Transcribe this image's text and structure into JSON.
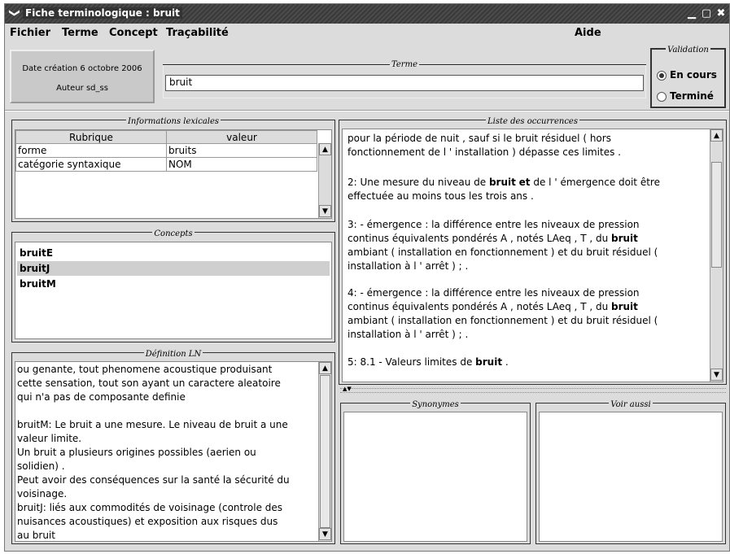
{
  "window": {
    "title": "Fiche terminologique : bruit",
    "menu_glyph": "❯",
    "min_glyph": "▁",
    "max_glyph": "▢",
    "close_glyph": "✖"
  },
  "menu": {
    "fichier": "Fichier",
    "terme": "Terme",
    "concept": "Concept",
    "tracabilite": "Traçabilité",
    "aide": "Aide"
  },
  "header": {
    "date_creation": "Date création  6 octobre 2006",
    "auteur": "Auteur sd_ss",
    "terme_legend": "Terme",
    "terme_value": "bruit",
    "validation_legend": "Validation",
    "en_cours": "En cours",
    "termine": "Terminé"
  },
  "lexical": {
    "legend": "Informations lexicales",
    "col_rubrique": "Rubrique",
    "col_valeur": "valeur",
    "rows": [
      {
        "rubrique": "forme",
        "valeur": "bruits"
      },
      {
        "rubrique": "catégorie syntaxique",
        "valeur": "NOM"
      }
    ]
  },
  "concepts": {
    "legend": "Concepts",
    "items": [
      "bruitE",
      "bruitJ",
      "bruitM"
    ],
    "selected": "bruitJ"
  },
  "definition": {
    "legend": "Définition LN",
    "text": "ou genante, tout phenomene acoustique produisant\ncette sensation, tout son ayant un caractere aleatoire\nqui n'a pas de composante definie\n\nbruitM: Le bruit a une mesure. Le niveau de bruit a une\nvaleur limite.\nUn bruit a plusieurs origines possibles (aerien ou\nsolidien) .\nPeut avoir des conséquences sur la santé la sécurité du\nvoisinage.\nbruitJ: liés aux commodités de voisinage (controle des\nnuisances acoustiques) et exposition aux risques dus\nau bruit"
  },
  "occurrences": {
    "legend": "Liste des occurrences",
    "items": [
      {
        "l1": "pour la période de nuit , sauf si le bruit résiduel ( hors",
        "l2": "fonctionnement de l ' installation ) dépasse ces limites ."
      },
      {
        "l1a": " 2: Une mesure du niveau de ",
        "bold1": "bruit",
        "l1b": " ",
        "bold2": "et",
        "l1c": " de l ' émergence doit être",
        "l2": "effectuée au moins tous les trois ans ."
      },
      {
        "l1": " 3: - émergence : la différence entre les niveaux de pression",
        "l2a": "continus équivalents pondérés A , notés LAeq , T , du ",
        "bold": "bruit",
        "l3": "ambiant ( installation en fonctionnement ) et du bruit résiduel (",
        "l4": "installation à l ' arrêt ) ; ."
      },
      {
        "l1": " 4: - émergence : la différence entre les niveaux de pression",
        "l2a": "continus équivalents pondérés A , notés LAeq , T , du ",
        "bold": "bruit",
        "l3": "ambiant ( installation en fonctionnement ) et du bruit résiduel (",
        "l4": "installation à l ' arrêt ) ; ."
      },
      {
        "l1a": " 5: 8.1 - Valeurs limites de ",
        "bold": "bruit",
        "l1b": " ."
      }
    ]
  },
  "synonymes": {
    "legend": "Synonymes"
  },
  "voir_aussi": {
    "legend": "Voir aussi"
  }
}
